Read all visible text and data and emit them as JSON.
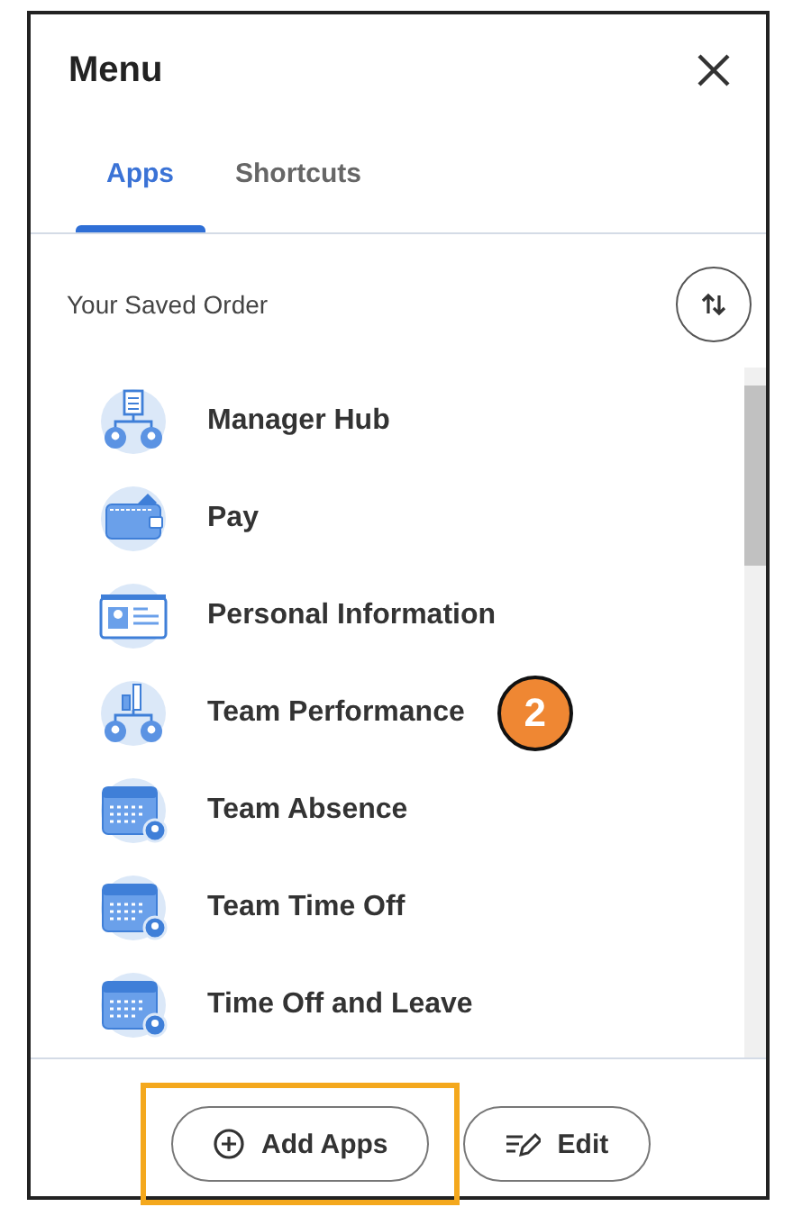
{
  "title": "Menu",
  "tabs": [
    {
      "label": "Apps",
      "selected": true
    },
    {
      "label": "Shortcuts",
      "selected": false
    }
  ],
  "section_label": "Your Saved Order",
  "apps": [
    {
      "label": "Manager Hub",
      "kind": "hub"
    },
    {
      "label": "Pay",
      "kind": "wallet"
    },
    {
      "label": "Personal Information",
      "kind": "card"
    },
    {
      "label": "Team Performance",
      "kind": "performance",
      "callout": "2"
    },
    {
      "label": "Team Absence",
      "kind": "calendar"
    },
    {
      "label": "Team Time Off",
      "kind": "calendar"
    },
    {
      "label": "Time Off and Leave",
      "kind": "calendar"
    }
  ],
  "buttons": [
    {
      "label": "Add Apps",
      "kind": "add",
      "highlighted": true
    },
    {
      "label": "Edit",
      "kind": "edit",
      "highlighted": false
    }
  ]
}
